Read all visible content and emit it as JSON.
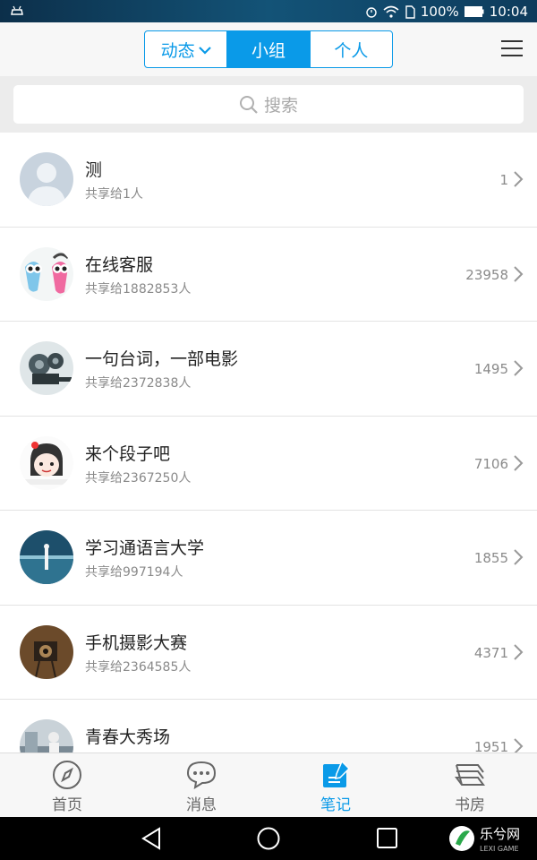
{
  "status_bar": {
    "battery": "100%",
    "time": "10:04"
  },
  "header": {
    "tabs": [
      {
        "label": "动态",
        "has_dropdown": true,
        "active": false
      },
      {
        "label": "小组",
        "active": true
      },
      {
        "label": "个人",
        "active": false
      }
    ],
    "menu_icon": "hamburger-icon"
  },
  "search": {
    "placeholder": "搜索"
  },
  "groups": [
    {
      "name": "测",
      "shared": "共享给1人",
      "count": "1",
      "avatar": "default-user"
    },
    {
      "name": "在线客服",
      "shared": "共享给1882853人",
      "count": "23958",
      "avatar": "cartoon-pair"
    },
    {
      "name": "一句台词，一部电影",
      "shared": "共享给2372838人",
      "count": "1495",
      "avatar": "film-projector"
    },
    {
      "name": "来个段子吧",
      "shared": "共享给2367250人",
      "count": "7106",
      "avatar": "cartoon-girl"
    },
    {
      "name": "学习通语言大学",
      "shared": "共享给997194人",
      "count": "1855",
      "avatar": "lake-photo"
    },
    {
      "name": "手机摄影大赛",
      "shared": "共享给2364585人",
      "count": "4371",
      "avatar": "vintage-camera"
    },
    {
      "name": "青春大秀场",
      "shared": "",
      "count": "1951",
      "avatar": "street-photo"
    }
  ],
  "tabbar": [
    {
      "label": "首页",
      "icon": "compass-icon",
      "active": false
    },
    {
      "label": "消息",
      "icon": "chat-bubble-icon",
      "active": false
    },
    {
      "label": "笔记",
      "icon": "note-edit-icon",
      "active": true
    },
    {
      "label": "书房",
      "icon": "books-icon",
      "active": false
    }
  ],
  "watermark": {
    "text": "乐兮网",
    "sub": "LEXI GAME"
  },
  "colors": {
    "accent": "#0a9ae8",
    "text": "#222222",
    "muted": "#8a8a8a"
  }
}
